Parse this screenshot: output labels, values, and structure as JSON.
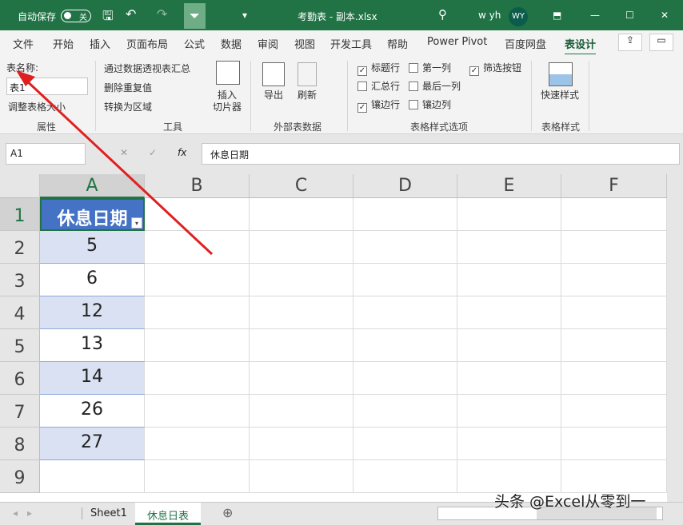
{
  "titlebar": {
    "autosave": "自动保存",
    "autosave_state": "关",
    "filename": "考勤表 - 副本.xlsx",
    "user": "w yh",
    "avatar": "WY"
  },
  "menu": [
    "文件",
    "开始",
    "插入",
    "页面布局",
    "公式",
    "数据",
    "审阅",
    "视图",
    "开发工具",
    "帮助",
    "Power Pivot",
    "百度网盘",
    "表设计"
  ],
  "ribbon": {
    "table_name_label": "表名称:",
    "table_name": "表1",
    "resize": "调整表格大小",
    "group_props": "属性",
    "pivot": "通过数据透视表汇总",
    "remove_dup": "删除重复值",
    "convert": "转换为区域",
    "slicer1": "插入",
    "slicer2": "切片器",
    "group_tools": "工具",
    "export": "导出",
    "refresh": "刷新",
    "group_external": "外部表数据",
    "options": [
      {
        "label": "标题行",
        "checked": true
      },
      {
        "label": "第一列",
        "checked": false
      },
      {
        "label": "筛选按钮",
        "checked": true
      },
      {
        "label": "汇总行",
        "checked": false
      },
      {
        "label": "最后一列",
        "checked": false
      },
      {
        "label": "镶边行",
        "checked": true
      },
      {
        "label": "镶边列",
        "checked": false
      }
    ],
    "group_options": "表格样式选项",
    "quick_styles": "快速样式",
    "group_styles": "表格样式"
  },
  "formula": {
    "namebox": "A1",
    "fx": "fx",
    "value": "休息日期"
  },
  "columns": [
    "A",
    "B",
    "C",
    "D",
    "E",
    "F"
  ],
  "rows": [
    "1",
    "2",
    "3",
    "4",
    "5",
    "6",
    "7",
    "8",
    "9"
  ],
  "table": {
    "header": "休息日期",
    "values": [
      "5",
      "6",
      "12",
      "13",
      "14",
      "26",
      "27"
    ]
  },
  "sheets": [
    "Sheet1",
    "休息日表"
  ],
  "watermark": "头条 @Excel从零到一"
}
